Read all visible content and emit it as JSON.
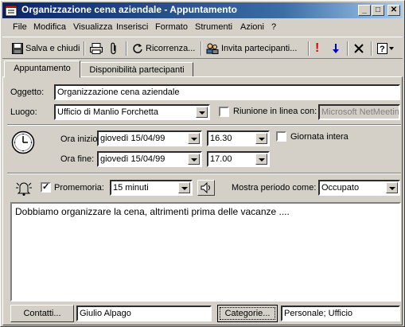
{
  "window": {
    "title": "Organizzazione cena aziendale - Appuntamento",
    "controls": {
      "minimize": "_",
      "maximize": "□",
      "close": "✕"
    }
  },
  "menu": [
    "File",
    "Modifica",
    "Visualizza",
    "Inserisci",
    "Formato",
    "Strumenti",
    "Azioni",
    "?"
  ],
  "toolbar": {
    "save_close": "Salva e chiudi",
    "recurrence": "Ricorrenza...",
    "invite": "Invita partecipanti...",
    "icons": [
      "save-icon",
      "print-icon",
      "attach-icon",
      "recurrence-icon",
      "invite-icon",
      "importance-high-icon",
      "importance-low-icon",
      "delete-icon",
      "help-icon"
    ]
  },
  "tabs": [
    "Appuntamento",
    "Disponibilità partecipanti"
  ],
  "form": {
    "subject_label": "Oggetto:",
    "subject_value": "Organizzazione cena aziendale",
    "location_label": "Luogo:",
    "location_value": "Ufficio di Manlio Forchetta",
    "online_label": "Riunione in linea con:",
    "online_value": "Microsoft NetMeeting",
    "start_label": "Ora inizio:",
    "start_date": "giovedì 15/04/99",
    "start_time": "16.30",
    "all_day_label": "Giornata intera",
    "end_label": "Ora fine:",
    "end_date": "giovedì 15/04/99",
    "end_time": "17.00",
    "reminder_label": "Promemoria:",
    "reminder_value": "15 minuti",
    "show_as_label": "Mostra periodo come:",
    "show_as_value": "Occupato"
  },
  "notes": "Dobbiamo organizzare la cena, altrimenti prima delle vacanze ....",
  "footer": {
    "contacts_button": "Contatti...",
    "contacts_value": "Giulio Alpago",
    "categories_button": "Categorie...",
    "categories_value": "Personale; Ufficio"
  },
  "colors": {
    "titlebar_start": "#0a246a",
    "titlebar_end": "#a6caf0",
    "face": "#d4d0c8",
    "importance_high": "#e00000",
    "importance_low": "#0000c0"
  }
}
